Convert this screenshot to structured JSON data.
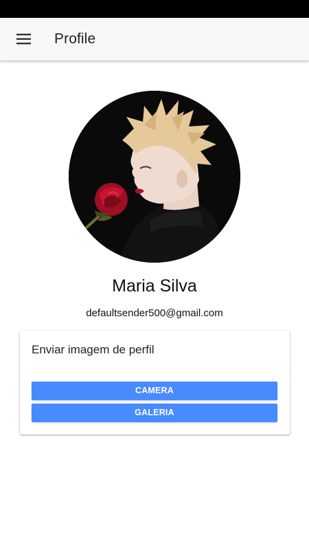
{
  "toolbar": {
    "title": "Profile",
    "menu_icon": "menu-icon"
  },
  "profile": {
    "name": "Maria Silva",
    "email": "defaultsender500@gmail.com",
    "avatar_description": "photo"
  },
  "upload_card": {
    "title": "Enviar imagem de perfil",
    "camera_label": "CAMERA",
    "gallery_label": "GALERIA"
  },
  "colors": {
    "accent": "#488aff",
    "toolbar_bg": "#f7f7f7",
    "status_bar": "#000000"
  }
}
